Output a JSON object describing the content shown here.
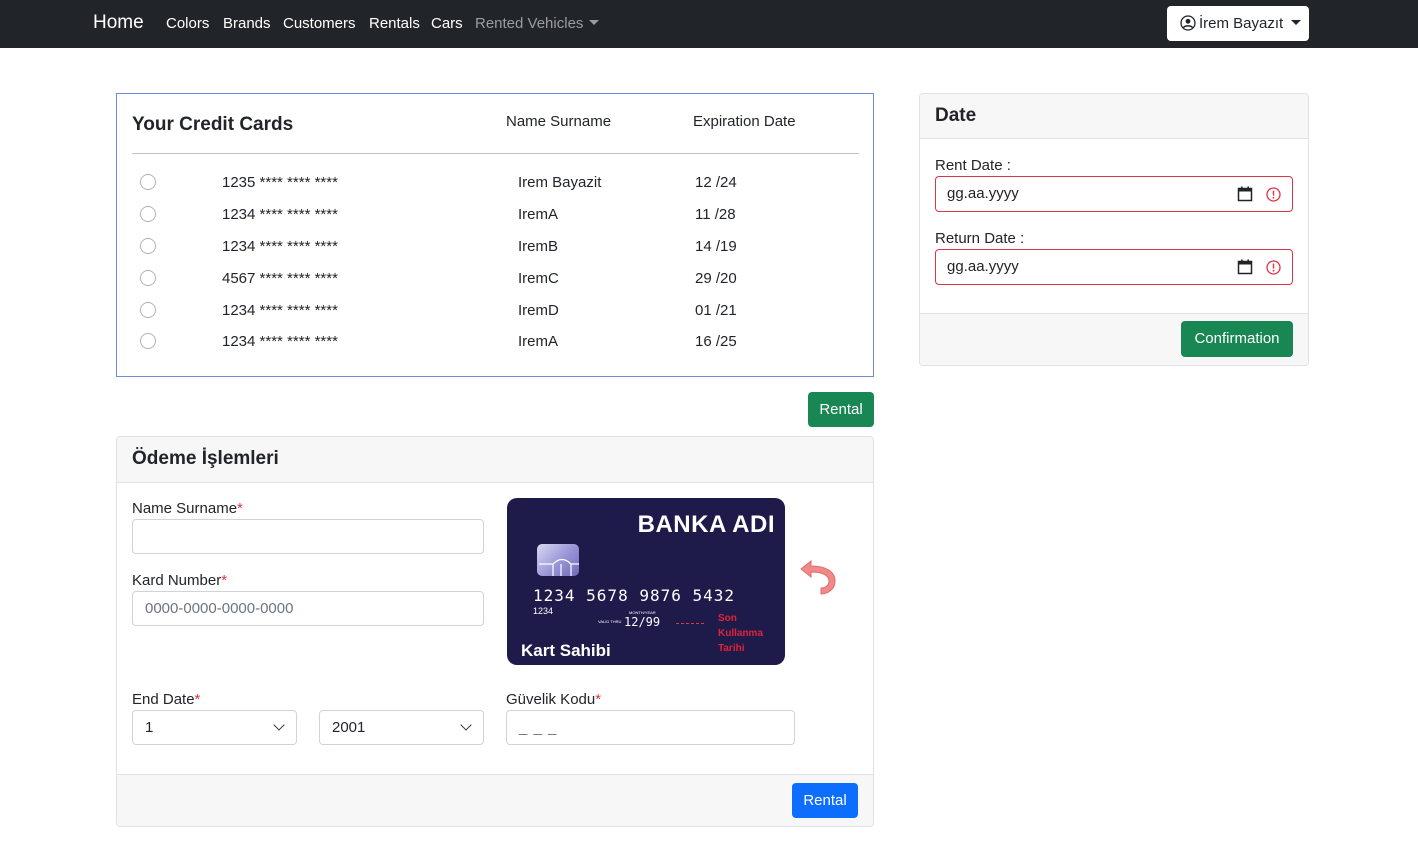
{
  "nav": {
    "brand": "Home",
    "links": [
      "Colors",
      "Brands",
      "Customers",
      "Rentals",
      "Cars"
    ],
    "dropdown": "Rented Vehicles",
    "user": "İrem Bayazıt"
  },
  "cards_panel": {
    "title": "Your Credit Cards",
    "col_name": "Name Surname",
    "col_exp": "Expiration Date",
    "rows": [
      {
        "number": "1235 **** **** ****",
        "name": "Irem Bayazit",
        "exp": "12 /24"
      },
      {
        "number": "1234 **** **** ****",
        "name": "IremA",
        "exp": "11 /28"
      },
      {
        "number": "1234 **** **** ****",
        "name": "IremB",
        "exp": "14 /19"
      },
      {
        "number": "4567 **** **** ****",
        "name": "IremC",
        "exp": "29 /20"
      },
      {
        "number": "1234 **** **** ****",
        "name": "IremD",
        "exp": "01 /21"
      },
      {
        "number": "1234 **** **** ****",
        "name": "IremA",
        "exp": "16 /25"
      }
    ],
    "rental_button": "Rental"
  },
  "payment": {
    "title": "Ödeme İşlemleri",
    "name_label": "Name Surname",
    "card_label": "Kard Number",
    "card_placeholder": "0000-0000-0000-0000",
    "end_date_label": "End Date",
    "month_value": "1",
    "year_value": "2001",
    "security_label": "Güvelik Kodu",
    "security_placeholder": "_ _ _",
    "required_mark": "*",
    "submit_button": "Rental",
    "card_visual": {
      "bank": "BANKA ADI",
      "number": "1234 5678 9876 5432",
      "small_number": "1234",
      "valid_thru": "VALID THRU",
      "month_year": "MONTH/YEAR",
      "expiry": "12/99",
      "note_line1": "Son",
      "note_line2": "Kullanma",
      "note_line3": "Tarihi",
      "holder": "Kart Sahibi"
    }
  },
  "date_panel": {
    "title": "Date",
    "rent_label": "Rent Date :",
    "rent_value": "gg.aa.yyyy",
    "return_label": "Return Date :",
    "return_value": "gg.aa.yyyy",
    "confirm_button": "Confirmation"
  },
  "colors": {
    "navbar": "#212529",
    "success": "#198754",
    "primary": "#0d6efd",
    "danger": "#dc3545",
    "card_bg": "#1e1a4a"
  }
}
